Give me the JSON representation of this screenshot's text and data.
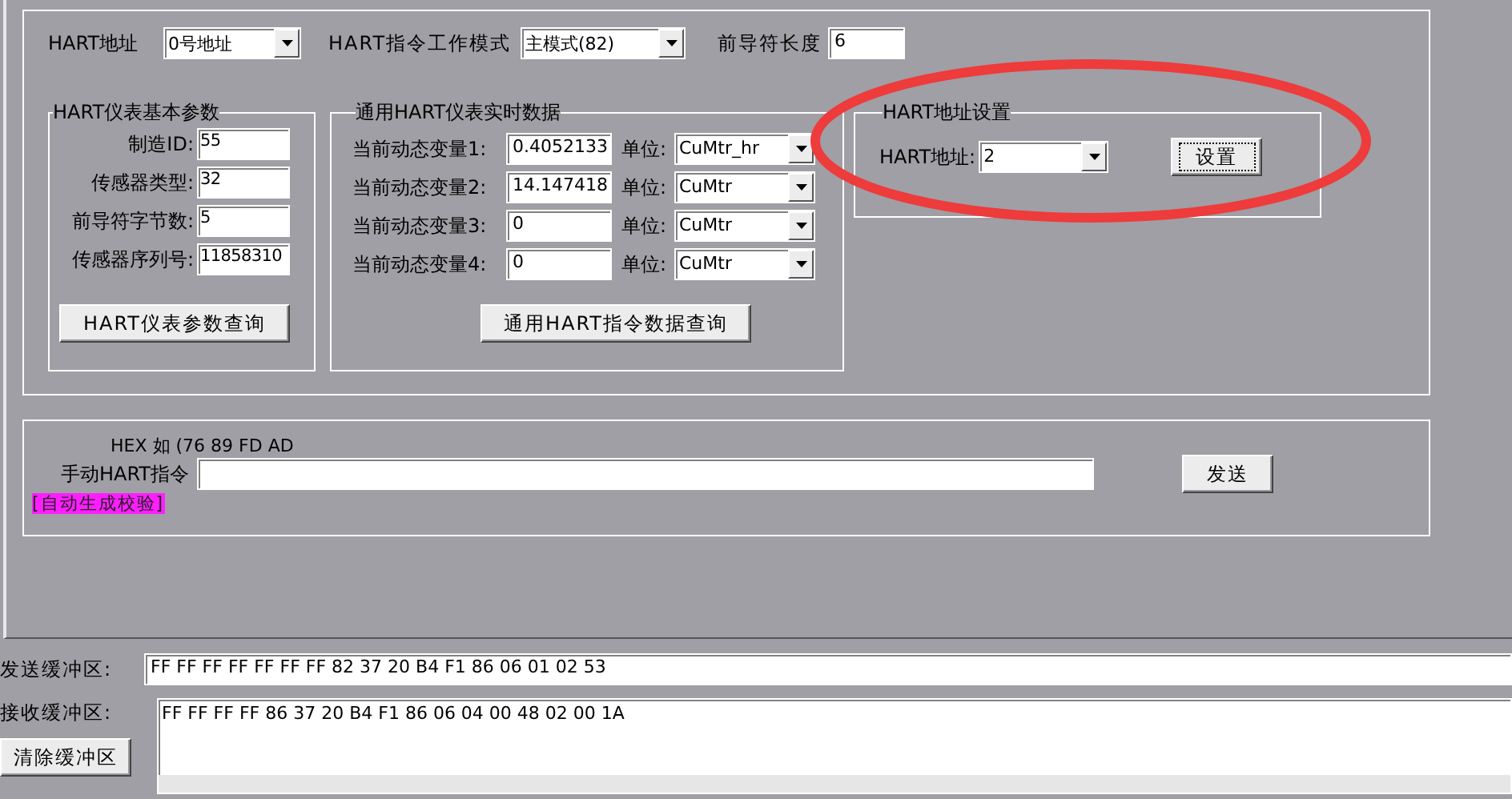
{
  "address_row": {
    "hart_address": {
      "label": "HART地址",
      "value": "0号地址"
    },
    "command_mode": {
      "label": "HART指令工作模式",
      "value": "主模式(82)"
    },
    "preamble_length": {
      "label": "前导符长度",
      "value": "6"
    }
  },
  "basic_params": {
    "title": "HART仪表基本参数",
    "fields": [
      {
        "label": "制造ID:",
        "value": "55"
      },
      {
        "label": "传感器类型:",
        "value": "32"
      },
      {
        "label": "前导符字节数:",
        "value": "5"
      },
      {
        "label": "传感器序列号:",
        "value": "11858310"
      }
    ],
    "button": "HART仪表参数查询"
  },
  "realtime_data": {
    "title": "通用HART仪表实时数据",
    "rows": [
      {
        "label": "当前动态变量1:",
        "value": "0.4052133",
        "unit_label": "单位:",
        "unit": "CuMtr_hr"
      },
      {
        "label": "当前动态变量2:",
        "value": "14.147418",
        "unit_label": "单位:",
        "unit": "CuMtr"
      },
      {
        "label": "当前动态变量3:",
        "value": "0",
        "unit_label": "单位:",
        "unit": "CuMtr"
      },
      {
        "label": "当前动态变量4:",
        "value": "0",
        "unit_label": "单位:",
        "unit": "CuMtr"
      }
    ],
    "button": "通用HART指令数据查询"
  },
  "address_setting": {
    "title": "HART地址设置",
    "label": "HART地址:",
    "value": "2",
    "button": {
      "label": "设置",
      "focused": true
    }
  },
  "manual_command": {
    "hint": "HEX 如 (76 89 FD AD",
    "label": "手动HART指令",
    "auto_checksum": "[自动生成校验]",
    "button": "发送"
  },
  "buffers": {
    "send": {
      "label": "发送缓冲区:",
      "value": "FF FF FF FF FF FF FF 82 37 20 B4 F1 86 06 01 02 53"
    },
    "receive": {
      "label": "接收缓冲区:",
      "value": "FF FF FF FF 86 37 20 B4 F1 86 06 04 00 48 02 00 1A"
    },
    "clear_button": "清除缓冲区"
  }
}
